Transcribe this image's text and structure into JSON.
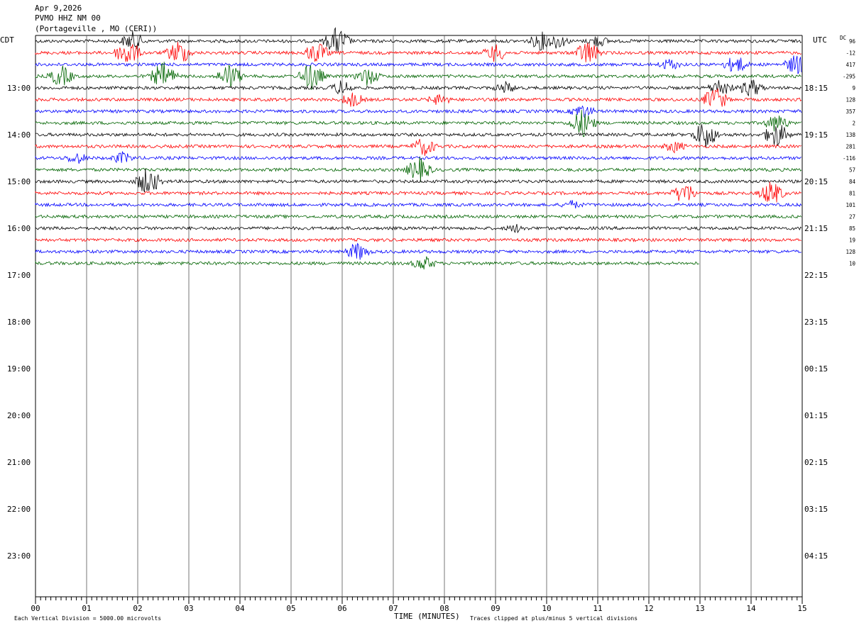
{
  "header": {
    "date": "Apr 9,2026",
    "station": "PVMO HHZ NM 00",
    "location": "(Portageville , MO (CERI))"
  },
  "left_label": "CDT",
  "right_label": "UTC",
  "dc_label": "DC",
  "chart_data": {
    "type": "line",
    "title": "Apr 9,2026",
    "xlabel": "TIME (MINUTES)",
    "xlim": [
      0,
      15
    ],
    "x_ticks": [
      "00",
      "01",
      "02",
      "03",
      "04",
      "05",
      "06",
      "07",
      "08",
      "09",
      "10",
      "11",
      "12",
      "13",
      "14",
      "15"
    ],
    "hour_labels_cdt": [
      "13:00",
      "14:00",
      "15:00",
      "16:00",
      "17:00",
      "18:00",
      "19:00",
      "20:00",
      "21:00",
      "22:00",
      "23:00"
    ],
    "hour_labels_utc": [
      "18:15",
      "19:15",
      "20:15",
      "21:15",
      "22:15",
      "23:15",
      "00:15",
      "01:15",
      "02:15",
      "03:15",
      "04:15"
    ],
    "colors": [
      "#000000",
      "#ff0000",
      "#0000ff",
      "#006400"
    ],
    "dc_offsets": [
      "96",
      "-12",
      "417",
      "-295",
      "9",
      "128",
      "357",
      "2",
      "138",
      "281",
      "-116",
      "57",
      "84",
      "81",
      "101",
      "27",
      "85",
      "19",
      "128",
      "10"
    ],
    "traces_minutes_recorded": [
      15,
      15,
      15,
      15,
      15,
      15,
      15,
      15,
      15,
      15,
      15,
      15,
      15,
      15,
      15,
      15,
      15,
      15,
      15,
      13
    ],
    "footer_left": "Each Vertical Division = 5000.00 microvolts",
    "footer_right": "Traces clipped at plus/minus 5 vertical divisions"
  }
}
